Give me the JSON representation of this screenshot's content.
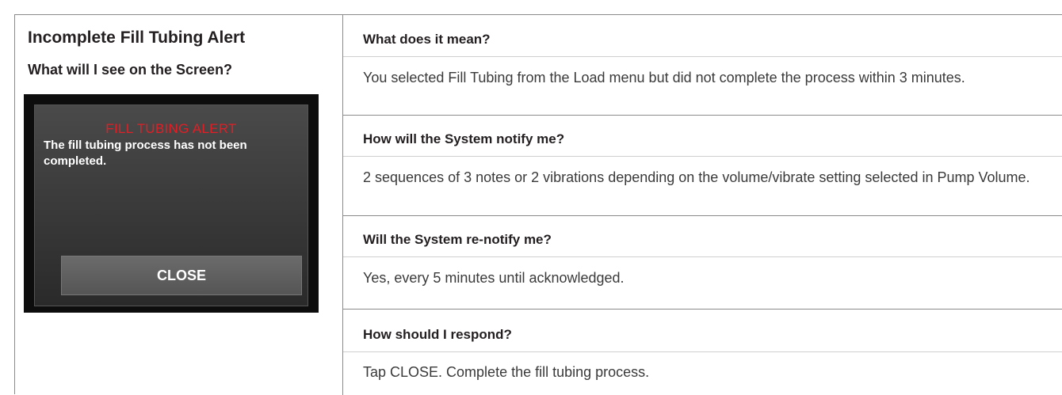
{
  "left": {
    "title": "Incomplete Fill Tubing Alert",
    "subtitle": "What will I see on the Screen?",
    "screen": {
      "alert_title": "FILL TUBING ALERT",
      "alert_body": "The fill tubing process has not been completed.",
      "close_label": "CLOSE",
      "alert_title_color": "#e01f26"
    }
  },
  "sections": [
    {
      "question": "What does it mean?",
      "answer": "You selected Fill Tubing from the Load menu but did not complete the process within 3 minutes."
    },
    {
      "question": "How will the System notify me?",
      "answer": "2 sequences of 3 notes or 2 vibrations depending on the volume/vibrate setting selected in Pump Volume."
    },
    {
      "question": "Will the System re-notify me?",
      "answer": "Yes, every 5 minutes until acknowledged."
    },
    {
      "question": "How should I respond?",
      "answer": "Tap CLOSE. Complete the fill tubing process."
    }
  ]
}
